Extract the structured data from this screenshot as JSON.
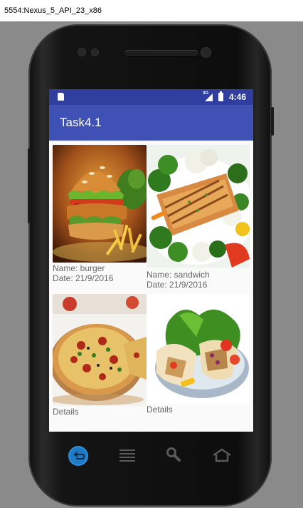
{
  "window": {
    "title": "5554:Nexus_5_API_23_x86"
  },
  "status_bar": {
    "network": "3G",
    "time": "4:46",
    "icons": [
      "sd-card-icon",
      "signal-icon",
      "battery-icon"
    ]
  },
  "app_bar": {
    "title": "Task4.1"
  },
  "items": [
    {
      "name_line": "Name: burger",
      "date_line": "Date: 21/9/2016",
      "image": "burger-image"
    },
    {
      "name_line": "Name: sandwich",
      "date_line": "Date: 21/9/2016",
      "image": "grilled-salmon-image"
    },
    {
      "details": "Details",
      "image": "pizza-image"
    },
    {
      "details": "Details",
      "image": "wrap-salad-image"
    }
  ],
  "nav_bar": {
    "icons": [
      "back-icon",
      "menu-icon",
      "search-icon",
      "home-icon"
    ]
  },
  "colors": {
    "primary": "#3f51b5",
    "primary_dark": "#303f9f",
    "caption": "#666666",
    "emulator_bg": "#8a8a8a"
  }
}
